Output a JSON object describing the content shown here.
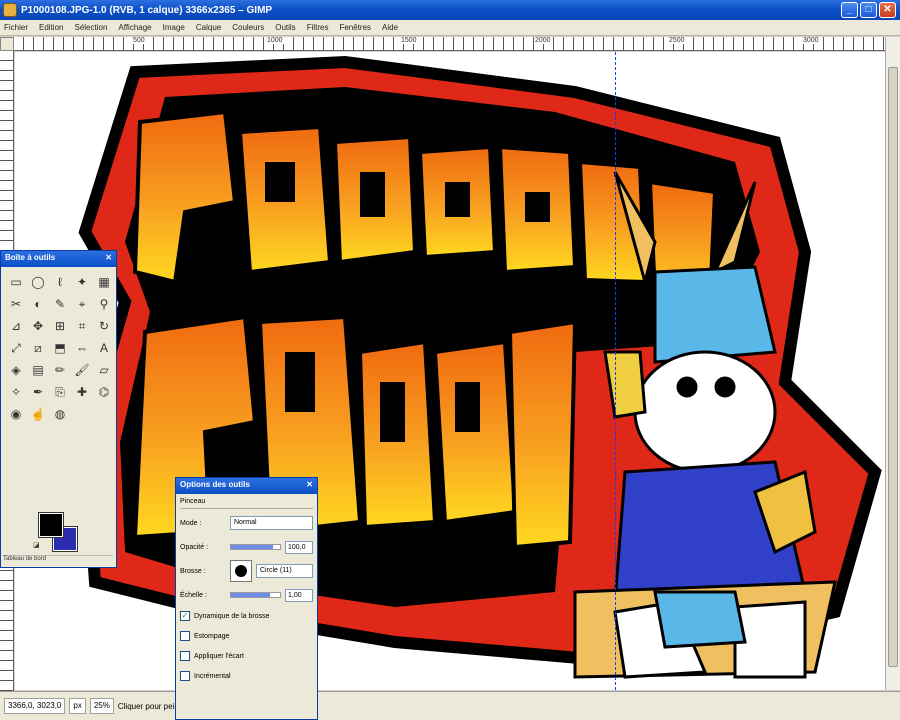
{
  "window": {
    "title": "P1000108.JPG-1.0 (RVB, 1 calque) 3366x2365 – GIMP",
    "minimize": "_",
    "maximize": "□",
    "close": "✕"
  },
  "menu": [
    "Fichier",
    "Edition",
    "Sélection",
    "Affichage",
    "Image",
    "Calque",
    "Couleurs",
    "Outils",
    "Filtres",
    "Fenêtres",
    "Aide"
  ],
  "ruler": {
    "ticks": [
      "500",
      "1000",
      "1500",
      "2000",
      "2500",
      "3000"
    ]
  },
  "toolbox": {
    "title": "Boîte à outils",
    "tools": [
      {
        "icon": "rect-select-icon",
        "glyph": "▭"
      },
      {
        "icon": "ellipse-select-icon",
        "glyph": "◯"
      },
      {
        "icon": "lasso-icon",
        "glyph": "ℓ"
      },
      {
        "icon": "fuzzy-select-icon",
        "glyph": "✦"
      },
      {
        "icon": "color-select-icon",
        "glyph": "▦"
      },
      {
        "icon": "scissors-icon",
        "glyph": "✂"
      },
      {
        "icon": "foreground-select-icon",
        "glyph": "◐"
      },
      {
        "icon": "paths-icon",
        "glyph": "✎"
      },
      {
        "icon": "color-picker-icon",
        "glyph": "⌖"
      },
      {
        "icon": "zoom-icon",
        "glyph": "⚲"
      },
      {
        "icon": "measure-icon",
        "glyph": "⊿"
      },
      {
        "icon": "move-icon",
        "glyph": "✥"
      },
      {
        "icon": "align-icon",
        "glyph": "⊞"
      },
      {
        "icon": "crop-icon",
        "glyph": "⌗"
      },
      {
        "icon": "rotate-icon",
        "glyph": "↻"
      },
      {
        "icon": "scale-icon",
        "glyph": "⤢"
      },
      {
        "icon": "shear-icon",
        "glyph": "⧄"
      },
      {
        "icon": "perspective-icon",
        "glyph": "⬒"
      },
      {
        "icon": "flip-icon",
        "glyph": "⇔"
      },
      {
        "icon": "text-icon",
        "glyph": "A"
      },
      {
        "icon": "bucket-fill-icon",
        "glyph": "◈"
      },
      {
        "icon": "blend-icon",
        "glyph": "▤"
      },
      {
        "icon": "pencil-icon",
        "glyph": "✏"
      },
      {
        "icon": "paintbrush-icon",
        "glyph": "🖌"
      },
      {
        "icon": "eraser-icon",
        "glyph": "▱"
      },
      {
        "icon": "airbrush-icon",
        "glyph": "✧"
      },
      {
        "icon": "ink-icon",
        "glyph": "✒"
      },
      {
        "icon": "clone-icon",
        "glyph": "⎘"
      },
      {
        "icon": "heal-icon",
        "glyph": "✚"
      },
      {
        "icon": "perspective-clone-icon",
        "glyph": "⌬"
      },
      {
        "icon": "blur-icon",
        "glyph": "◉"
      },
      {
        "icon": "smudge-icon",
        "glyph": "☝"
      },
      {
        "icon": "dodge-burn-icon",
        "glyph": "◍"
      }
    ],
    "fg_color": "#000000",
    "bg_color": "#2c2cb0",
    "footer": "Tableau de bord"
  },
  "tool_options": {
    "title": "Options des outils",
    "heading": "Pinceau",
    "mode_label": "Mode :",
    "mode_value": "Normal",
    "opacity_label": "Opacité :",
    "opacity_value": "100,0",
    "opacity_level": 0.85,
    "brush_label": "Brosse :",
    "brush_value": "Circle (11)",
    "scale_label": "Échelle :",
    "scale_value": "1,00",
    "scale_level": 0.8,
    "checks": [
      {
        "label": "Dynamique de la brosse",
        "checked": true
      },
      {
        "label": "Estompage",
        "checked": false
      },
      {
        "label": "Appliquer l'écart",
        "checked": false
      },
      {
        "label": "Incrémental",
        "checked": false
      }
    ]
  },
  "status": {
    "coords": "3366,0, 3023,0",
    "unit": "px",
    "zoom": "25%",
    "message": "Cliquer pour peindre"
  }
}
